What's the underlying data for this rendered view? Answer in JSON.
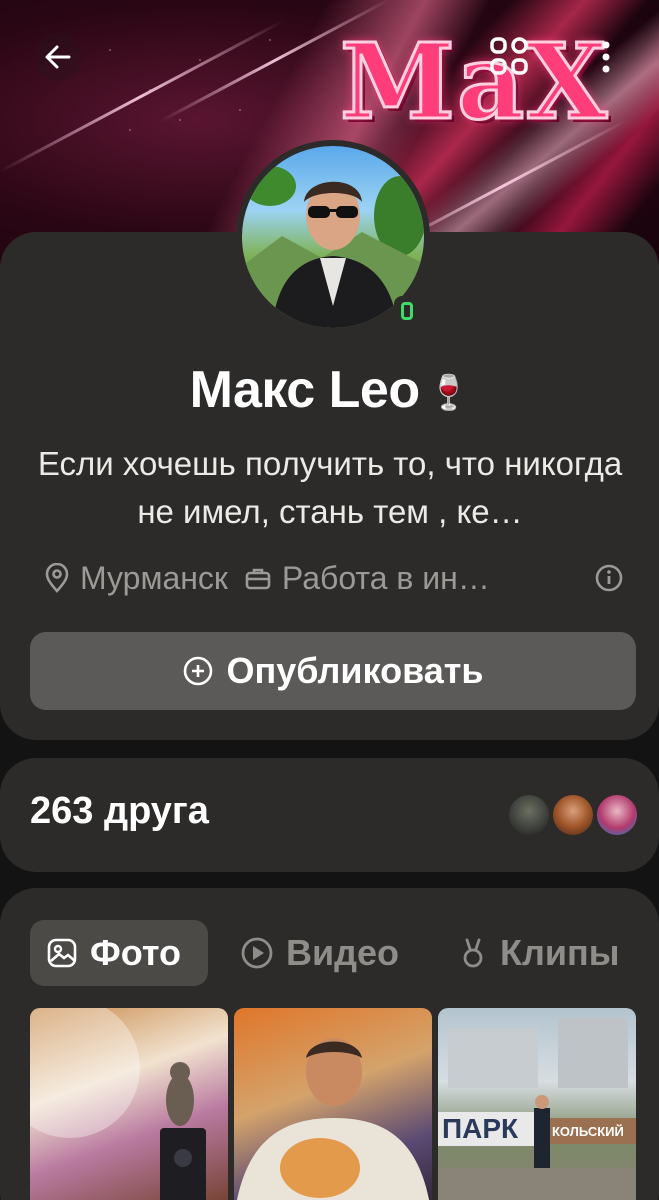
{
  "cover": {
    "logo_text": "MaX"
  },
  "header": {
    "back_icon": "arrow-left-icon",
    "apps_icon": "apps-grid-icon",
    "more_icon": "more-vertical-icon"
  },
  "profile": {
    "name": "Макс Leo",
    "name_emoji": "🍷",
    "bio": "Если хочешь получить то, что никогда не имел, стань тем , ке…",
    "location": "Мурманск",
    "work": "Работа в ин…",
    "online": true,
    "publish_label": "Опубликовать"
  },
  "friends": {
    "count_label": "263 друга"
  },
  "tabs": [
    {
      "label": "Фото",
      "icon": "image-icon",
      "active": true
    },
    {
      "label": "Видео",
      "icon": "play-circle-icon",
      "active": false
    },
    {
      "label": "Клипы",
      "icon": "clips-icon",
      "active": false
    }
  ],
  "photos": [
    {
      "caption": ""
    },
    {
      "caption": ""
    },
    {
      "caption": "ПАРК КОЛЬСКИЙ"
    }
  ],
  "colors": {
    "card": "#2c2b29",
    "online": "#3ddb6a",
    "button": "#5b5a58",
    "muted": "#9c9a96"
  }
}
